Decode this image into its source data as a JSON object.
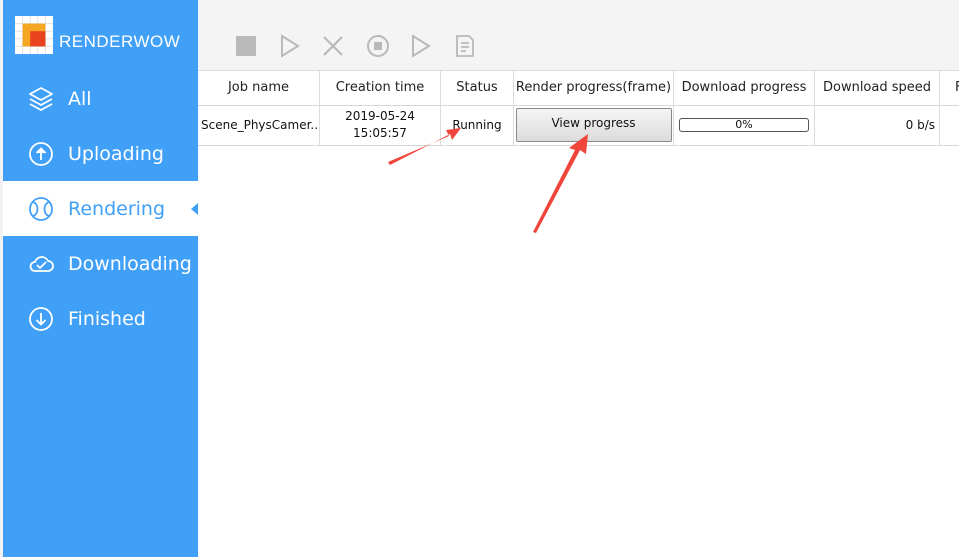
{
  "app": {
    "brand_name": "RENDERWOW"
  },
  "colors": {
    "sidebar_bg": "#40a0f8",
    "active_text": "#40a0f8",
    "toolbar_bg": "#f4f4f4",
    "annotation_arrow": "#f0453a"
  },
  "sidebar": {
    "items": [
      {
        "label": "All",
        "icon": "layers-icon"
      },
      {
        "label": "Uploading",
        "icon": "upload-circle-icon"
      },
      {
        "label": "Rendering",
        "icon": "render-swirl-icon",
        "active": true
      },
      {
        "label": "Downloading",
        "icon": "cloud-check-icon"
      },
      {
        "label": "Finished",
        "icon": "cloud-download-icon"
      }
    ]
  },
  "toolbar": {
    "buttons": [
      "stop-icon",
      "play-outline-icon",
      "close-x-icon",
      "stop-circle-icon",
      "play-outline-icon",
      "document-icon"
    ]
  },
  "table": {
    "columns": [
      "Job name",
      "Creation time",
      "Status",
      "Render progress(frame)",
      "Download progress",
      "Download speed",
      "F"
    ],
    "rows": [
      {
        "job_name": "Scene_PhysCamer...",
        "creation_date": "2019-05-24",
        "creation_time": "15:05:57",
        "status": "Running",
        "render_progress_button": "View progress",
        "download_progress": 0,
        "download_progress_label": "0%",
        "download_speed": "0 b/s"
      }
    ]
  }
}
